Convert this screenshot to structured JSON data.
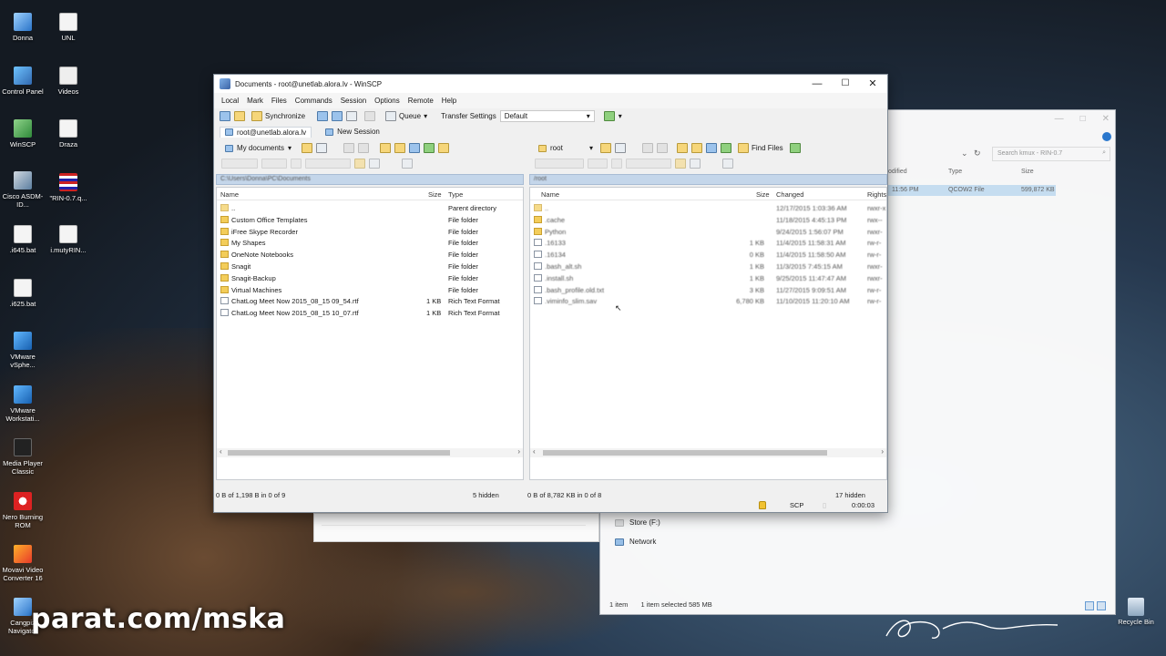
{
  "desktop": {
    "icons_col1": [
      "Donna",
      "Control Panel",
      "WinSCP",
      "Cisco ASDM-ID...",
      ".i645.bat",
      ".i625.bat",
      "VMware vSphe...",
      "VMware Workstati...",
      "Media Player Classic",
      "Nero Burning ROM",
      "Movavi Video Converter 16",
      "Cangpiz Navigator"
    ],
    "icons_col2": [
      "UNL",
      "Videos",
      "Draza",
      "\"RIN-0.7.q...",
      "i.mutyRIN..."
    ],
    "recycle_bin": "Recycle Bin"
  },
  "explorer": {
    "search_placeholder": "Search kmux - RIN-0.7",
    "col_modified": "odified",
    "col_type": "Type",
    "col_size": "Size",
    "selected_row": {
      "modified": "11:56 PM",
      "type": "QCOW2 File",
      "size": "599,872 KB"
    },
    "nav": [
      "Store (F:)",
      "Network"
    ],
    "status": {
      "count": "1 item",
      "selected": "1 item selected  585 MB"
    }
  },
  "winscp": {
    "title": "Documents - root@unetlab.alora.lv - WinSCP",
    "menu": [
      "Local",
      "Mark",
      "Files",
      "Commands",
      "Session",
      "Options",
      "Remote",
      "Help"
    ],
    "toolbar": {
      "synchronize": "Synchronize",
      "queue": "Queue",
      "transfer_settings_label": "Transfer Settings",
      "transfer_settings_value": "Default"
    },
    "tabs": {
      "session": "root@unetlab.alora.lv",
      "new_session": "New Session"
    },
    "local": {
      "location": "My documents",
      "path": "C:\\Users\\Donna\\PC\\Documents",
      "columns": {
        "name": "Name",
        "size": "Size",
        "type": "Type"
      },
      "rows": [
        {
          "icon": "up",
          "name": "..",
          "size": "",
          "type": "Parent directory"
        },
        {
          "icon": "folder",
          "name": "Custom Office Templates",
          "size": "",
          "type": "File folder"
        },
        {
          "icon": "folder",
          "name": "iFree Skype Recorder",
          "size": "",
          "type": "File folder"
        },
        {
          "icon": "folder",
          "name": "My Shapes",
          "size": "",
          "type": "File folder"
        },
        {
          "icon": "folder",
          "name": "OneNote Notebooks",
          "size": "",
          "type": "File folder"
        },
        {
          "icon": "folder",
          "name": "Snagit",
          "size": "",
          "type": "File folder"
        },
        {
          "icon": "folder",
          "name": "Snagit-Backup",
          "size": "",
          "type": "File folder"
        },
        {
          "icon": "folder",
          "name": "Virtual Machines",
          "size": "",
          "type": "File folder"
        },
        {
          "icon": "file",
          "name": "ChatLog Meet Now 2015_08_15 09_54.rtf",
          "size": "1 KB",
          "type": "Rich Text Format"
        },
        {
          "icon": "file",
          "name": "ChatLog Meet Now 2015_08_15 10_07.rtf",
          "size": "1 KB",
          "type": "Rich Text Format"
        }
      ],
      "status": "0 B of 1,198 B in 0 of 9",
      "hidden": "5 hidden"
    },
    "remote": {
      "location": "root",
      "find_files": "Find Files",
      "path": "/root",
      "columns": {
        "name": "Name",
        "size": "Size",
        "changed": "Changed",
        "rights": "Rights"
      },
      "rows": [
        {
          "icon": "up",
          "name": "..",
          "size": "",
          "changed": "12/17/2015 1:03:36 AM",
          "rights": "rwxr-x"
        },
        {
          "icon": "folder",
          "name": ".cache",
          "size": "",
          "changed": "11/18/2015 4:45:13 PM",
          "rights": "rwx--"
        },
        {
          "icon": "folder",
          "name": "Python",
          "size": "",
          "changed": "9/24/2015 1:56:07 PM",
          "rights": "rwxr-"
        },
        {
          "icon": "file",
          "name": ".16133",
          "size": "1 KB",
          "changed": "11/4/2015 11:58:31 AM",
          "rights": "rw-r-"
        },
        {
          "icon": "file",
          "name": ".16134",
          "size": "0 KB",
          "changed": "11/4/2015 11:58:50 AM",
          "rights": "rw-r-"
        },
        {
          "icon": "file",
          "name": ".bash_alt.sh",
          "size": "1 KB",
          "changed": "11/3/2015 7:45:15 AM",
          "rights": "rwxr-"
        },
        {
          "icon": "file",
          "name": ".install.sh",
          "size": "1 KB",
          "changed": "9/25/2015 11:47:47 AM",
          "rights": "rwxr-"
        },
        {
          "icon": "file",
          "name": ".bash_profile.old.txt",
          "size": "3 KB",
          "changed": "11/27/2015 9:09:51 AM",
          "rights": "rw-r-"
        },
        {
          "icon": "file",
          "name": ".viminfo_slim.sav",
          "size": "6,780 KB",
          "changed": "11/10/2015 11:20:10 AM",
          "rights": "rw-r-"
        }
      ],
      "status": "0 B of 8,782 KB in 0 of 8",
      "hidden": "17 hidden"
    },
    "statusbar": {
      "protocol": "SCP",
      "time": "0:00:03"
    }
  },
  "watermark": "parat.com/mska"
}
